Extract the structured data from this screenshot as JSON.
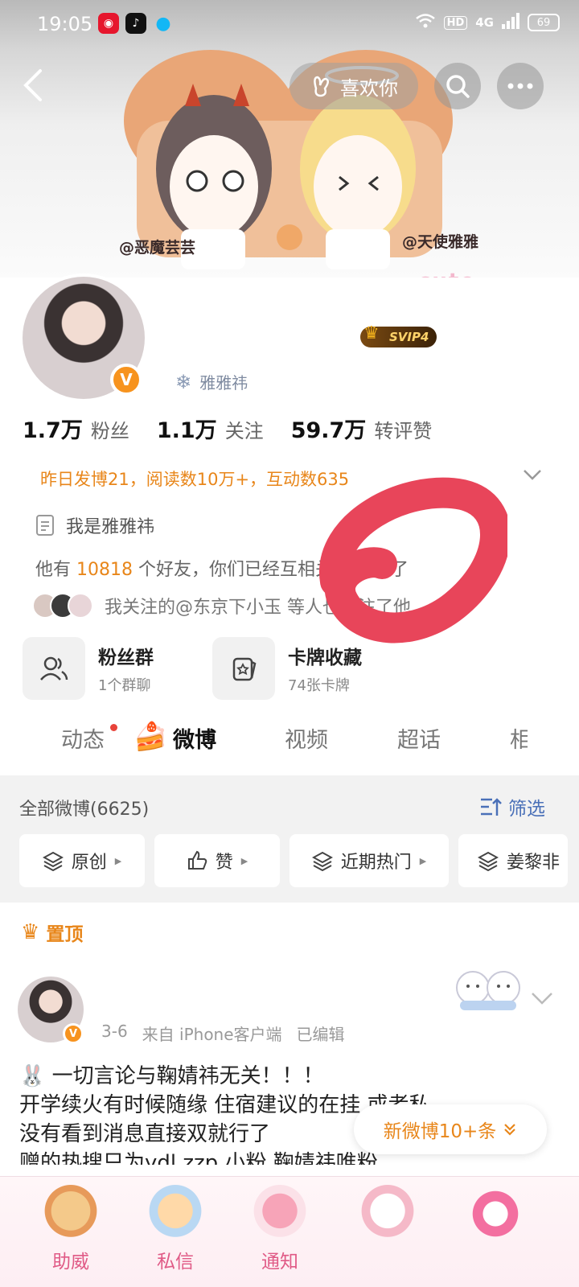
{
  "status_bar": {
    "time": "19:05",
    "hd": "HD",
    "network": "4G",
    "battery": "69"
  },
  "header": {
    "like_label": "喜欢你"
  },
  "banner": {
    "tag_left": "@恶魔芸芸",
    "tag_right": "@天使雅雅",
    "deco": "cute"
  },
  "profile": {
    "svip": "SVIP4",
    "name_partial": "雅雅祎",
    "stats": [
      {
        "num": "1.7万",
        "label": "粉丝"
      },
      {
        "num": "1.1万",
        "label": "关注"
      },
      {
        "num": "59.7万",
        "label": "转评赞"
      }
    ],
    "summary": "昨日发博21，阅读数10万+，互动数635",
    "bio": "我是雅雅祎",
    "friends_prefix": "他有",
    "friends_count": "10818",
    "friends_suffix": "个好友，你们已经互相关注90天了",
    "mutual": "我关注的@东京下小玉 等人也关注了他"
  },
  "cards": [
    {
      "title": "粉丝群",
      "sub": "1个群聊"
    },
    {
      "title": "卡牌收藏",
      "sub": "74张卡牌"
    }
  ],
  "tabs": [
    "动态",
    "微博",
    "视频",
    "超话",
    "相"
  ],
  "feed": {
    "title": "全部微博(6625)",
    "filter": "筛选",
    "chips": [
      "原创",
      "赞",
      "近期热门",
      "姜黎非"
    ]
  },
  "pinned": "置顶",
  "post": {
    "date": "3-6",
    "source": "来自 iPhone客户端",
    "edited": "已编辑",
    "lines": [
      "🐰 一切言论与鞠婧祎无关！！！",
      "开学续火有时候随缘 住宿建议的在挂 或者私",
      "没有看到消息直接双就行了",
      "赠的热搜只为ydl zzp 小粉 鞠婧祎唯粉"
    ]
  },
  "new_posts": "新微博10+条",
  "bottom_bar": [
    "助威",
    "私信",
    "通知",
    "",
    ""
  ],
  "colors": {
    "accent": "#e8861a",
    "link": "#4a70b8",
    "verified": "#f7931e",
    "annotation": "#e8455a"
  }
}
